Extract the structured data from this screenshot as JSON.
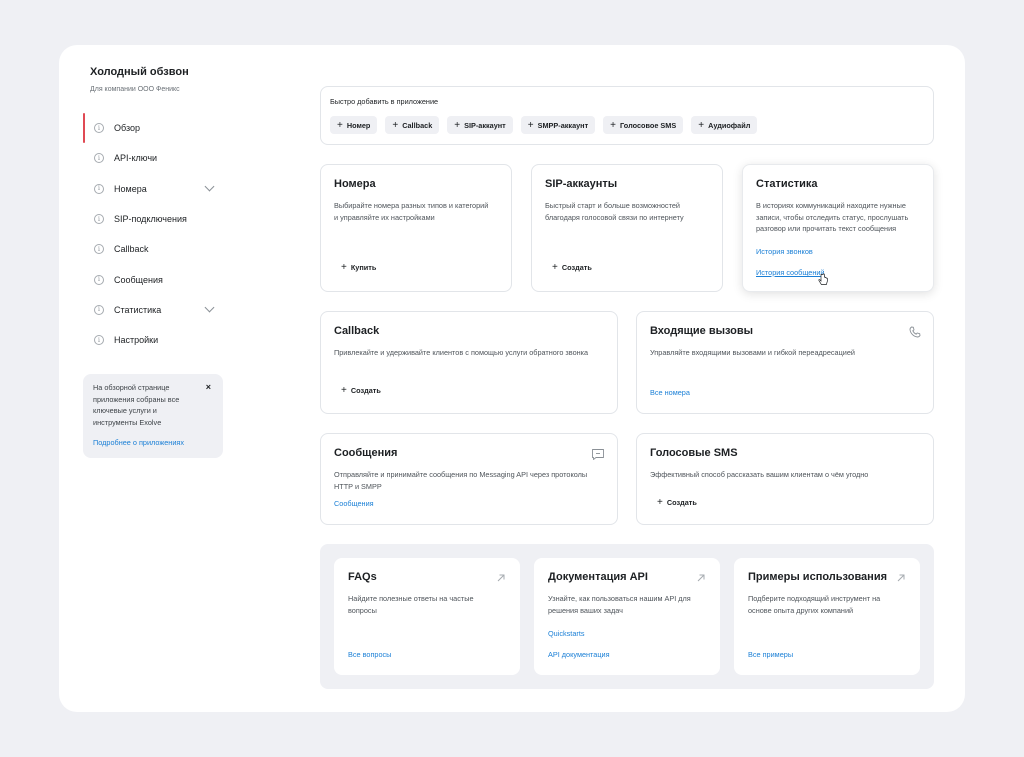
{
  "app": {
    "title": "Холодный обзвон",
    "subtitle": "Для компании ООО Феникс"
  },
  "sidebar": {
    "items": [
      {
        "label": "Обзор",
        "active": true
      },
      {
        "label": "API-ключи"
      },
      {
        "label": "Номера",
        "expandable": true
      },
      {
        "label": "SIP-подключения"
      },
      {
        "label": "Callback"
      },
      {
        "label": "Сообщения"
      },
      {
        "label": "Статистика",
        "expandable": true
      },
      {
        "label": "Настройки"
      }
    ]
  },
  "tip": {
    "text": "На обзорной странице приложения собраны все ключевые услуги и инструменты Exolve",
    "close": "×",
    "link": "Подробнее о приложениях"
  },
  "quick_add": {
    "title": "Быстро добавить в приложение",
    "items": [
      "Номер",
      "Callback",
      "SIP-аккаунт",
      "SMPP-аккаунт",
      "Голосовое SMS",
      "Аудиофайл"
    ]
  },
  "cards": {
    "numbers": {
      "title": "Номера",
      "desc": "Выбирайте номера разных типов и категорий и управляйте их настройками",
      "action": "Купить"
    },
    "sip": {
      "title": "SIP-аккаунты",
      "desc": "Быстрый старт и больше возможностей благодаря голосовой связи по интернету",
      "action": "Создать"
    },
    "stats": {
      "title": "Статистика",
      "desc": "В историях коммуникаций находите нужные записи, чтобы отследить статус, прослушать разговор или прочитать текст сообщения",
      "link1": "История звонков",
      "link2": "История сообщений"
    },
    "callback": {
      "title": "Callback",
      "desc": "Привлекайте и удерживайте клиентов с помощью услуги обратного звонка",
      "action": "Создать"
    },
    "incoming": {
      "title": "Входящие вызовы",
      "desc": "Управляйте входящими вызовами и гибкой переадресацией",
      "link": "Все номера"
    },
    "messages": {
      "title": "Сообщения",
      "desc": "Отправляйте и принимайте сообщения по Messaging API через протоколы HTTP и SMPP",
      "link": "Сообщения"
    },
    "voice_sms": {
      "title": "Голосовые SMS",
      "desc": "Эффективный способ рассказать вашим клиентам о чём угодно",
      "action": "Создать"
    }
  },
  "resources": {
    "faq": {
      "title": "FAQs",
      "desc": "Найдите полезные ответы на частые вопросы",
      "link": "Все вопросы"
    },
    "docs": {
      "title": "Документация API",
      "desc": "Узнайте, как пользоваться нашим API для решения ваших задач",
      "link1": "Quickstarts",
      "link2": "API документация"
    },
    "examples": {
      "title": "Примеры использования",
      "desc": "Подберите подходящий инструмент на основе опыта других компаний",
      "link": "Все примеры"
    }
  },
  "colors": {
    "accent": "#e04a54",
    "link": "#1a7fd6",
    "background": "#eff0f4"
  }
}
